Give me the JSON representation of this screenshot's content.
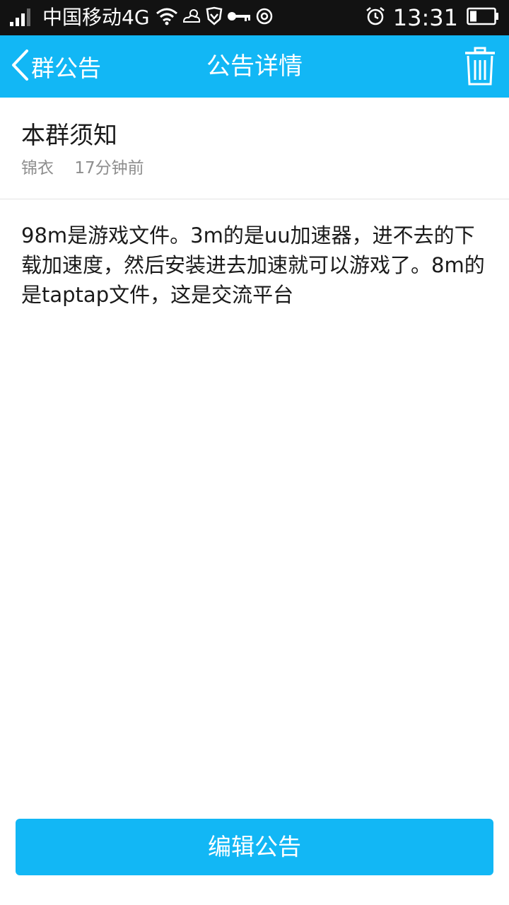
{
  "status_bar": {
    "carrier": "中国移动4G",
    "time": "13:31",
    "icons": [
      "signal-icon",
      "wifi-icon",
      "weather-icon",
      "vpn-shield-icon",
      "key-icon",
      "sync-icon",
      "alarm-icon",
      "battery-icon"
    ]
  },
  "titlebar": {
    "back_label": "群公告",
    "title": "公告详情",
    "delete_icon": "trash-icon"
  },
  "notice": {
    "title": "本群须知",
    "author": "锦衣",
    "time": "17分钟前",
    "body": "98m是游戏文件。3m的是uu加速器，进不去的下载加速度，然后安装进去加速就可以游戏了。8m的是taptap文件，这是交流平台"
  },
  "actions": {
    "edit_label": "编辑公告"
  },
  "colors": {
    "accent": "#12b7f5",
    "status_bar": "#121212"
  }
}
